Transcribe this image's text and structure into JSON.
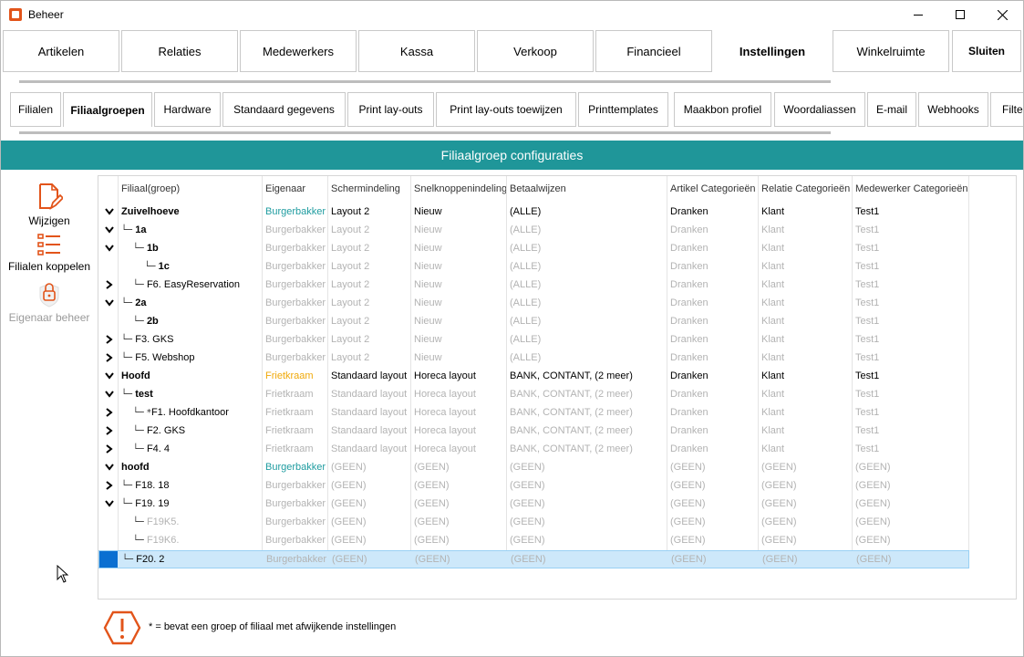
{
  "window": {
    "title": "Beheer"
  },
  "main_tabs": [
    {
      "label": "Artikelen"
    },
    {
      "label": "Relaties"
    },
    {
      "label": "Medewerkers"
    },
    {
      "label": "Kassa"
    },
    {
      "label": "Verkoop"
    },
    {
      "label": "Financieel"
    },
    {
      "label": "Instellingen",
      "active": true
    },
    {
      "label": "Winkelruimte"
    },
    {
      "label": "Sluiten"
    }
  ],
  "sub_tabs": [
    {
      "label": "Filialen"
    },
    {
      "label": "Filiaalgroepen",
      "active": true
    },
    {
      "label": "Hardware"
    },
    {
      "label": "Standaard gegevens"
    },
    {
      "label": "Print lay-outs"
    },
    {
      "label": "Print lay-outs toewijzen"
    },
    {
      "label": "Printtemplates"
    },
    {
      "label": "Maakbon profiel"
    },
    {
      "label": "Woordaliassen"
    },
    {
      "label": "E-mail"
    },
    {
      "label": "Webhooks"
    },
    {
      "label": "Filte"
    }
  ],
  "section": {
    "title": "Filiaalgroep configuraties"
  },
  "sidebar": {
    "wijzigen": "Wijzigen",
    "koppelen": "Filialen koppelen",
    "eigenaar": "Eigenaar beheer"
  },
  "columns": {
    "filiaal": "Filiaal(groep)",
    "eigenaar": "Eigenaar",
    "scherm": "Schermindeling",
    "snelknop": "Snelknoppenindeling",
    "betaal": "Betaalwijzen",
    "artikel": "Artikel Categorieën",
    "relatie": "Relatie Categorieën",
    "medewerker": "Medewerker Categorieën"
  },
  "rows": [
    {
      "chev": "down",
      "name": "Zuivelhoeve",
      "indent": "",
      "bold": true,
      "dim": false,
      "owner": "Burgerbakker",
      "owner_color": "teal",
      "scherm": "Layout 2",
      "snel": "Nieuw",
      "betaal": "(ALLE)",
      "art": "Dranken",
      "rel": "Klant",
      "med": "Test1"
    },
    {
      "chev": "down",
      "name": "1a",
      "indent": "└─ ",
      "bold": true,
      "dim": true,
      "owner": "Burgerbakker",
      "scherm": "Layout 2",
      "snel": "Nieuw",
      "betaal": "(ALLE)",
      "art": "Dranken",
      "rel": "Klant",
      "med": "Test1"
    },
    {
      "chev": "down",
      "name": "1b",
      "indent": "    └─ ",
      "bold": true,
      "dim": true,
      "owner": "Burgerbakker",
      "scherm": "Layout 2",
      "snel": "Nieuw",
      "betaal": "(ALLE)",
      "art": "Dranken",
      "rel": "Klant",
      "med": "Test1"
    },
    {
      "chev": "",
      "name": "1c",
      "indent": "        └─ ",
      "bold": true,
      "dim": true,
      "owner": "Burgerbakker",
      "scherm": "Layout 2",
      "snel": "Nieuw",
      "betaal": "(ALLE)",
      "art": "Dranken",
      "rel": "Klant",
      "med": "Test1"
    },
    {
      "chev": "right",
      "name": "F6. EasyReservation",
      "indent": "    └─ ",
      "bold": false,
      "dim": true,
      "owner": "Burgerbakker",
      "scherm": "Layout 2",
      "snel": "Nieuw",
      "betaal": "(ALLE)",
      "art": "Dranken",
      "rel": "Klant",
      "med": "Test1"
    },
    {
      "chev": "down",
      "name": "2a",
      "indent": "└─ ",
      "bold": true,
      "dim": true,
      "owner": "Burgerbakker",
      "scherm": "Layout 2",
      "snel": "Nieuw",
      "betaal": "(ALLE)",
      "art": "Dranken",
      "rel": "Klant",
      "med": "Test1"
    },
    {
      "chev": "",
      "name": "2b",
      "indent": "    └─ ",
      "bold": true,
      "dim": true,
      "owner": "Burgerbakker",
      "scherm": "Layout 2",
      "snel": "Nieuw",
      "betaal": "(ALLE)",
      "art": "Dranken",
      "rel": "Klant",
      "med": "Test1"
    },
    {
      "chev": "right",
      "name": "F3. GKS",
      "indent": "└─ ",
      "bold": false,
      "dim": true,
      "owner": "Burgerbakker",
      "scherm": "Layout 2",
      "snel": "Nieuw",
      "betaal": "(ALLE)",
      "art": "Dranken",
      "rel": "Klant",
      "med": "Test1"
    },
    {
      "chev": "right",
      "name": "F5. Webshop",
      "indent": "└─ ",
      "bold": false,
      "dim": true,
      "owner": "Burgerbakker",
      "scherm": "Layout 2",
      "snel": "Nieuw",
      "betaal": "(ALLE)",
      "art": "Dranken",
      "rel": "Klant",
      "med": "Test1"
    },
    {
      "chev": "down",
      "name": "Hoofd",
      "indent": "",
      "bold": true,
      "dim": false,
      "owner": "Frietkraam",
      "owner_color": "orange",
      "scherm": "Standaard layout",
      "snel": "Horeca layout",
      "betaal": "BANK, CONTANT,  (2 meer)",
      "art": "Dranken",
      "rel": "Klant",
      "med": "Test1"
    },
    {
      "chev": "down",
      "name": "test",
      "indent": "└─ ",
      "bold": true,
      "dim": true,
      "owner": "Frietkraam",
      "scherm": "Standaard layout",
      "snel": "Horeca layout",
      "betaal": "BANK, CONTANT,  (2 meer)",
      "art": "Dranken",
      "rel": "Klant",
      "med": "Test1"
    },
    {
      "chev": "right",
      "name": "F1. Hoofdkantoor",
      "indent": "    └─ *",
      "bold": false,
      "dim": true,
      "owner": "Frietkraam",
      "scherm": "Standaard layout",
      "snel": "Horeca layout",
      "betaal": "BANK, CONTANT,  (2 meer)",
      "art": "Dranken",
      "rel": "Klant",
      "med": "Test1"
    },
    {
      "chev": "right",
      "name": "F2. GKS",
      "indent": "    └─ ",
      "bold": false,
      "dim": true,
      "owner": "Frietkraam",
      "scherm": "Standaard layout",
      "snel": "Horeca layout",
      "betaal": "BANK, CONTANT,  (2 meer)",
      "art": "Dranken",
      "rel": "Klant",
      "med": "Test1"
    },
    {
      "chev": "right",
      "name": "F4. 4",
      "indent": "    └─ ",
      "bold": false,
      "dim": true,
      "owner": "Frietkraam",
      "scherm": "Standaard layout",
      "snel": "Horeca layout",
      "betaal": "BANK, CONTANT,  (2 meer)",
      "art": "Dranken",
      "rel": "Klant",
      "med": "Test1"
    },
    {
      "chev": "down",
      "name": "hoofd",
      "indent": "",
      "bold": true,
      "dim": false,
      "owner": "Burgerbakker",
      "owner_color": "teal",
      "scherm": "(GEEN)",
      "snel": "(GEEN)",
      "betaal": "(GEEN)",
      "art": "(GEEN)",
      "rel": "(GEEN)",
      "med": "(GEEN)",
      "rest_dim": true
    },
    {
      "chev": "right",
      "name": "F18. 18",
      "indent": "└─ ",
      "bold": false,
      "dim": true,
      "owner": "Burgerbakker",
      "scherm": "(GEEN)",
      "snel": "(GEEN)",
      "betaal": "(GEEN)",
      "art": "(GEEN)",
      "rel": "(GEEN)",
      "med": "(GEEN)"
    },
    {
      "chev": "down",
      "name": "F19. 19",
      "indent": "└─ ",
      "bold": false,
      "dim": true,
      "owner": "Burgerbakker",
      "scherm": "(GEEN)",
      "snel": "(GEEN)",
      "betaal": "(GEEN)",
      "art": "(GEEN)",
      "rel": "(GEEN)",
      "med": "(GEEN)"
    },
    {
      "chev": "",
      "name": "F19K5.",
      "indent": "    └─ ",
      "bold": false,
      "dim": true,
      "name_dim": true,
      "owner": "Burgerbakker",
      "scherm": "(GEEN)",
      "snel": "(GEEN)",
      "betaal": "(GEEN)",
      "art": "(GEEN)",
      "rel": "(GEEN)",
      "med": "(GEEN)"
    },
    {
      "chev": "",
      "name": "F19K6.",
      "indent": "    └─ ",
      "bold": false,
      "dim": true,
      "name_dim": true,
      "owner": "Burgerbakker",
      "scherm": "(GEEN)",
      "snel": "(GEEN)",
      "betaal": "(GEEN)",
      "art": "(GEEN)",
      "rel": "(GEEN)",
      "med": "(GEEN)"
    },
    {
      "chev": "",
      "name": "F20. 2",
      "indent": "└─ ",
      "bold": false,
      "dim": true,
      "selected": true,
      "owner": "Burgerbakker",
      "scherm": "(GEEN)",
      "snel": "(GEEN)",
      "betaal": "(GEEN)",
      "art": "(GEEN)",
      "rel": "(GEEN)",
      "med": "(GEEN)"
    }
  ],
  "legend": {
    "text": "* = bevat een groep of filiaal met afwijkende instellingen"
  },
  "colors": {
    "accent": "#1f9699",
    "icon": "#e2541a",
    "owner_teal": "#1f9ca0",
    "owner_orange": "#f0a90a"
  }
}
